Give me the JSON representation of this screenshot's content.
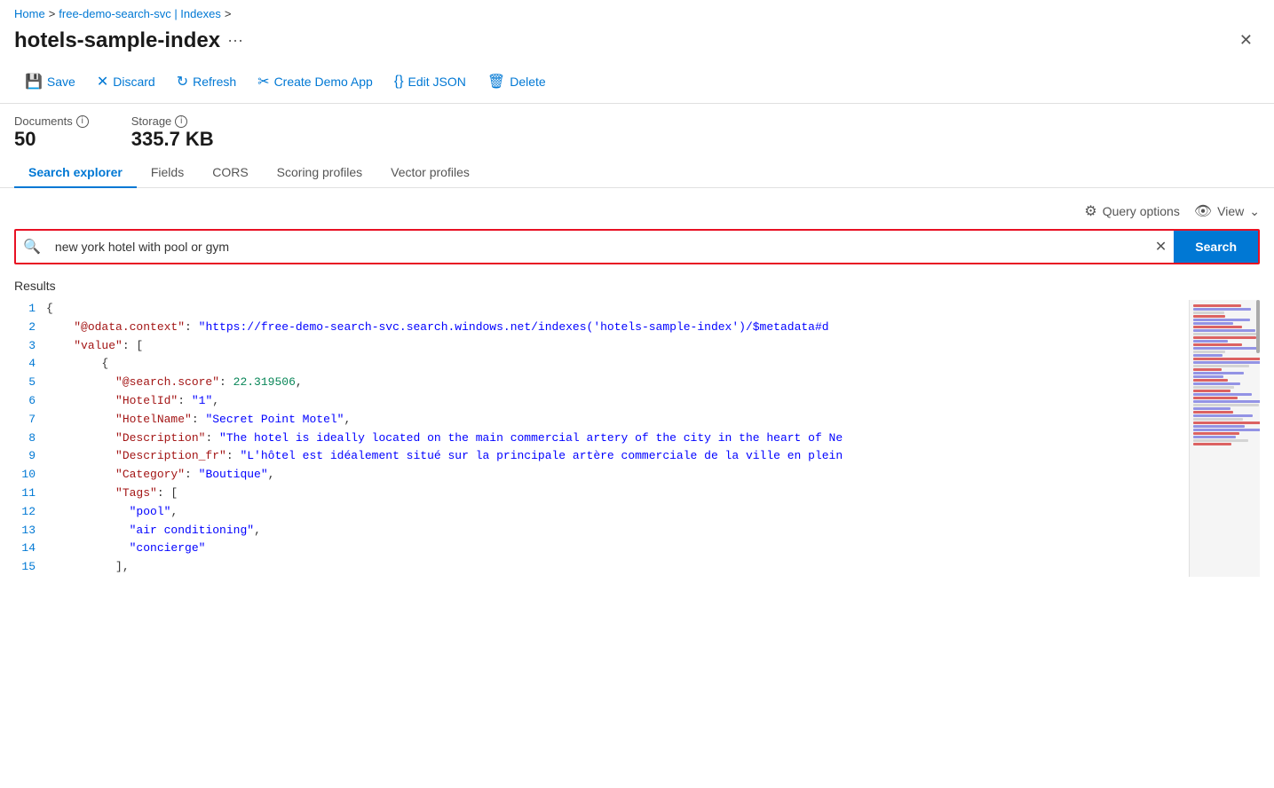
{
  "breadcrumb": {
    "home": "Home",
    "separator1": ">",
    "service": "free-demo-search-svc | Indexes",
    "separator2": ">"
  },
  "page": {
    "title": "hotels-sample-index",
    "ellipsis": "···"
  },
  "toolbar": {
    "save": "Save",
    "discard": "Discard",
    "refresh": "Refresh",
    "create_demo_app": "Create Demo App",
    "edit_json": "Edit JSON",
    "delete": "Delete"
  },
  "stats": {
    "documents_label": "Documents",
    "documents_value": "50",
    "storage_label": "Storage",
    "storage_value": "335.7 KB"
  },
  "tabs": [
    {
      "id": "search-explorer",
      "label": "Search explorer",
      "active": true
    },
    {
      "id": "fields",
      "label": "Fields",
      "active": false
    },
    {
      "id": "cors",
      "label": "CORS",
      "active": false
    },
    {
      "id": "scoring-profiles",
      "label": "Scoring profiles",
      "active": false
    },
    {
      "id": "vector-profiles",
      "label": "Vector profiles",
      "active": false
    }
  ],
  "search": {
    "query_options_label": "Query options",
    "view_label": "View",
    "search_placeholder": "Search",
    "search_value": "new york hotel with pool or gym",
    "search_button_label": "Search"
  },
  "results": {
    "label": "Results",
    "lines": [
      {
        "num": "1",
        "text": "{",
        "parts": [
          {
            "type": "brace",
            "val": "{"
          }
        ]
      },
      {
        "num": "2",
        "text": "  \"@odata.context\": \"https://free-demo-search-svc.search.windows.net/indexes('hotels-sample-index')/$metadata#d",
        "parts": [
          {
            "type": "indent",
            "val": "    "
          },
          {
            "type": "key",
            "val": "\"@odata.context\""
          },
          {
            "type": "brace",
            "val": ": "
          },
          {
            "type": "string",
            "val": "\"https://free-demo-search-svc.search.windows.net/indexes('hotels-sample-index')/$metadata#d"
          }
        ]
      },
      {
        "num": "3",
        "text": "  \"value\": [",
        "parts": [
          {
            "type": "indent",
            "val": "    "
          },
          {
            "type": "key",
            "val": "\"value\""
          },
          {
            "type": "brace",
            "val": ": ["
          }
        ]
      },
      {
        "num": "4",
        "text": "    {",
        "parts": [
          {
            "type": "indent",
            "val": "        "
          },
          {
            "type": "brace",
            "val": "{"
          }
        ]
      },
      {
        "num": "5",
        "text": "      \"@search.score\": 22.319506,",
        "parts": [
          {
            "type": "indent",
            "val": "          "
          },
          {
            "type": "key",
            "val": "\"@search.score\""
          },
          {
            "type": "brace",
            "val": ": "
          },
          {
            "type": "number",
            "val": "22.319506"
          },
          {
            "type": "brace",
            "val": ","
          }
        ]
      },
      {
        "num": "6",
        "text": "      \"HotelId\": \"1\",",
        "parts": [
          {
            "type": "indent",
            "val": "          "
          },
          {
            "type": "key",
            "val": "\"HotelId\""
          },
          {
            "type": "brace",
            "val": ": "
          },
          {
            "type": "string",
            "val": "\"1\""
          },
          {
            "type": "brace",
            "val": ","
          }
        ]
      },
      {
        "num": "7",
        "text": "      \"HotelName\": \"Secret Point Motel\",",
        "parts": [
          {
            "type": "indent",
            "val": "          "
          },
          {
            "type": "key",
            "val": "\"HotelName\""
          },
          {
            "type": "brace",
            "val": ": "
          },
          {
            "type": "string",
            "val": "\"Secret Point Motel\""
          },
          {
            "type": "brace",
            "val": ","
          }
        ]
      },
      {
        "num": "8",
        "text": "      \"Description\": \"The hotel is ideally located on the main commercial artery of the city in the heart of Ne",
        "parts": [
          {
            "type": "indent",
            "val": "          "
          },
          {
            "type": "key",
            "val": "\"Description\""
          },
          {
            "type": "brace",
            "val": ": "
          },
          {
            "type": "string",
            "val": "\"The hotel is ideally located on the main commercial artery of the city in the heart of Ne"
          }
        ]
      },
      {
        "num": "9",
        "text": "      \"Description_fr\": \"L'hôtel est idéalement situé sur la principale artère commerciale de la ville en plein",
        "parts": [
          {
            "type": "indent",
            "val": "          "
          },
          {
            "type": "key",
            "val": "\"Description_fr\""
          },
          {
            "type": "brace",
            "val": ": "
          },
          {
            "type": "string",
            "val": "\"L'hôtel est idéalement situé sur la principale artère commerciale de la ville en plein"
          }
        ]
      },
      {
        "num": "10",
        "text": "      \"Category\": \"Boutique\",",
        "parts": [
          {
            "type": "indent",
            "val": "          "
          },
          {
            "type": "key",
            "val": "\"Category\""
          },
          {
            "type": "brace",
            "val": ": "
          },
          {
            "type": "string",
            "val": "\"Boutique\""
          },
          {
            "type": "brace",
            "val": ","
          }
        ]
      },
      {
        "num": "11",
        "text": "      \"Tags\": [",
        "parts": [
          {
            "type": "indent",
            "val": "          "
          },
          {
            "type": "key",
            "val": "\"Tags\""
          },
          {
            "type": "brace",
            "val": ": ["
          }
        ]
      },
      {
        "num": "12",
        "text": "        \"pool\",",
        "parts": [
          {
            "type": "indent",
            "val": "            "
          },
          {
            "type": "string",
            "val": "\"pool\""
          },
          {
            "type": "brace",
            "val": ","
          }
        ]
      },
      {
        "num": "13",
        "text": "        \"air conditioning\",",
        "parts": [
          {
            "type": "indent",
            "val": "            "
          },
          {
            "type": "string",
            "val": "\"air conditioning\""
          },
          {
            "type": "brace",
            "val": ","
          }
        ]
      },
      {
        "num": "14",
        "text": "        \"concierge\"",
        "parts": [
          {
            "type": "indent",
            "val": "            "
          },
          {
            "type": "string",
            "val": "\"concierge\""
          }
        ]
      },
      {
        "num": "15",
        "text": "      ],",
        "parts": [
          {
            "type": "indent",
            "val": "          "
          },
          {
            "type": "brace",
            "val": "],"
          }
        ]
      }
    ]
  },
  "colors": {
    "accent": "#0078d4",
    "danger": "#e81123",
    "json_key": "#a31515",
    "json_string": "#0000ff",
    "json_number": "#098658"
  }
}
